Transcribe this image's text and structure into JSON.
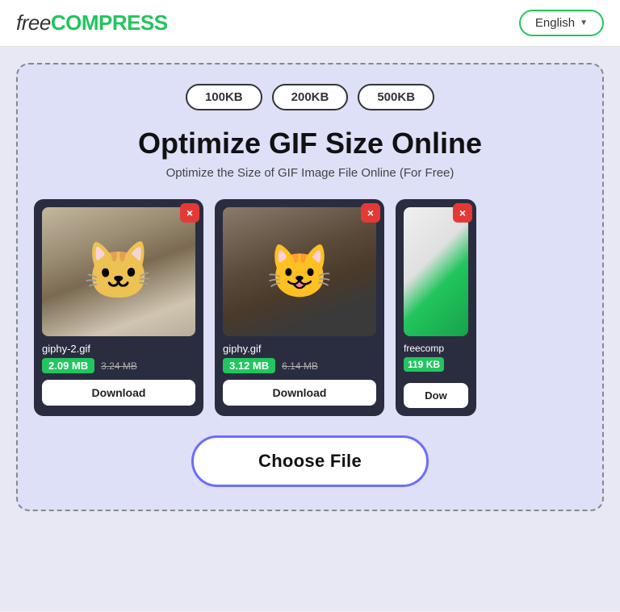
{
  "header": {
    "logo_free": "free",
    "logo_compress": "COMPRESS",
    "lang_label": "English",
    "lang_chevron": "▼"
  },
  "pills": [
    {
      "label": "100KB"
    },
    {
      "label": "200KB"
    },
    {
      "label": "500KB"
    }
  ],
  "main_title": "Optimize GIF Size Online",
  "sub_title": "Optimize the Size of GIF Image File Online (For Free)",
  "cards": [
    {
      "filename": "giphy-2.gif",
      "size_new": "2.09 MB",
      "size_old": "3.24 MB",
      "download_label": "Download",
      "close_label": "×",
      "type": "cat1"
    },
    {
      "filename": "giphy.gif",
      "size_new": "3.12 MB",
      "size_old": "6.14 MB",
      "download_label": "Download",
      "close_label": "×",
      "type": "cat2"
    },
    {
      "filename": "freecomp",
      "size_new": "119 KB",
      "download_label": "Dow",
      "close_label": "×",
      "type": "partial"
    }
  ],
  "choose_file_label": "Choose File"
}
